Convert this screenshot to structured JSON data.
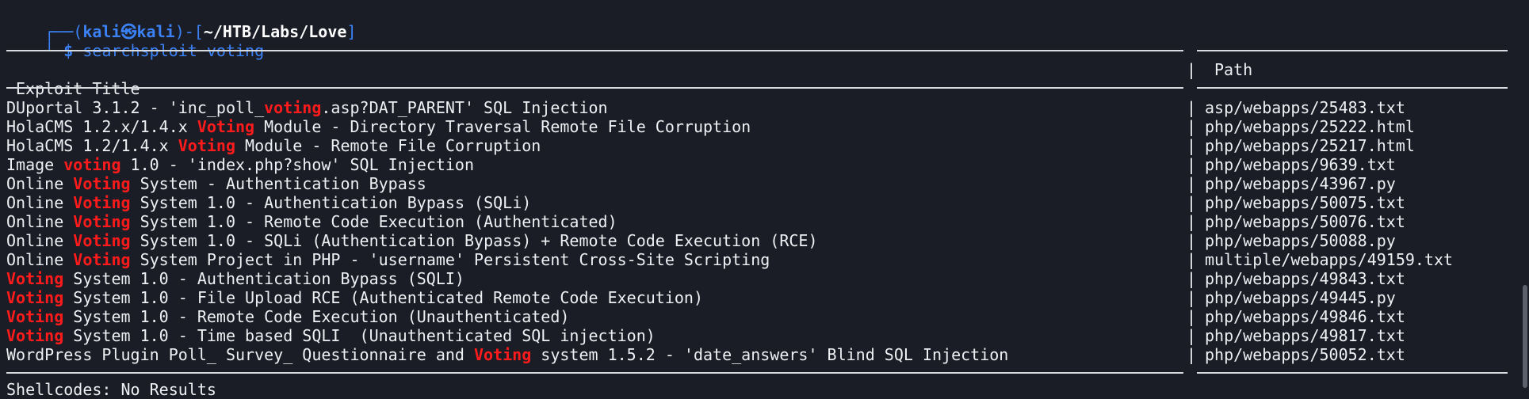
{
  "prompt": {
    "corner_top": "┌──(",
    "user": "kali",
    "at_symbol": "㉿",
    "host": "kali",
    "bracket_mid": ")-[",
    "path": "~/HTB/Labs/Love",
    "bracket_end": "]",
    "corner_bottom": "└─",
    "dollar": "$",
    "command": "searchsploit voting"
  },
  "header": {
    "title_label": "Exploit Title",
    "path_label": "Path",
    "separator": "|"
  },
  "rows": [
    {
      "pre": "DUportal 3.1.2 - 'inc_poll_",
      "hl": "voting",
      "post": ".asp?DAT_PARENT' SQL Injection",
      "sep": "|",
      "path": "asp/webapps/25483.txt"
    },
    {
      "pre": "HolaCMS 1.2.x/1.4.x ",
      "hl": "Voting",
      "post": " Module - Directory Traversal Remote File Corruption",
      "sep": "|",
      "path": "php/webapps/25222.html"
    },
    {
      "pre": "HolaCMS 1.2/1.4.x ",
      "hl": "Voting",
      "post": " Module - Remote File Corruption",
      "sep": "|",
      "path": "php/webapps/25217.html"
    },
    {
      "pre": "Image ",
      "hl": "voting",
      "post": " 1.0 - 'index.php?show' SQL Injection",
      "sep": "|",
      "path": "php/webapps/9639.txt"
    },
    {
      "pre": "Online ",
      "hl": "Voting",
      "post": " System - Authentication Bypass",
      "sep": "|",
      "path": "php/webapps/43967.py"
    },
    {
      "pre": "Online ",
      "hl": "Voting",
      "post": " System 1.0 - Authentication Bypass (SQLi)",
      "sep": "|",
      "path": "php/webapps/50075.txt"
    },
    {
      "pre": "Online ",
      "hl": "Voting",
      "post": " System 1.0 - Remote Code Execution (Authenticated)",
      "sep": "|",
      "path": "php/webapps/50076.txt"
    },
    {
      "pre": "Online ",
      "hl": "Voting",
      "post": " System 1.0 - SQLi (Authentication Bypass) + Remote Code Execution (RCE)",
      "sep": "|",
      "path": "php/webapps/50088.py"
    },
    {
      "pre": "Online ",
      "hl": "Voting",
      "post": " System Project in PHP - 'username' Persistent Cross-Site Scripting",
      "sep": "|",
      "path": "multiple/webapps/49159.txt"
    },
    {
      "pre": "",
      "hl": "Voting",
      "post": " System 1.0 - Authentication Bypass (SQLI)",
      "sep": "|",
      "path": "php/webapps/49843.txt"
    },
    {
      "pre": "",
      "hl": "Voting",
      "post": " System 1.0 - File Upload RCE (Authenticated Remote Code Execution)",
      "sep": "|",
      "path": "php/webapps/49445.py"
    },
    {
      "pre": "",
      "hl": "Voting",
      "post": " System 1.0 - Remote Code Execution (Unauthenticated)",
      "sep": "|",
      "path": "php/webapps/49846.txt"
    },
    {
      "pre": "",
      "hl": "Voting",
      "post": " System 1.0 - Time based SQLI  (Unauthenticated SQL injection)",
      "sep": "|",
      "path": "php/webapps/49817.txt"
    },
    {
      "pre": "WordPress Plugin Poll_ Survey_ Questionnaire and ",
      "hl": "Voting",
      "post": " system 1.5.2 - 'date_answers' Blind SQL Injection",
      "sep": "|",
      "path": "php/webapps/50052.txt"
    }
  ],
  "footer": {
    "partial": "Shellcodes: No Results"
  },
  "colors": {
    "background": "#1b1d26",
    "text": "#eef0f3",
    "prompt_blue": "#3b82f6",
    "highlight_red": "#ff1b1b"
  }
}
